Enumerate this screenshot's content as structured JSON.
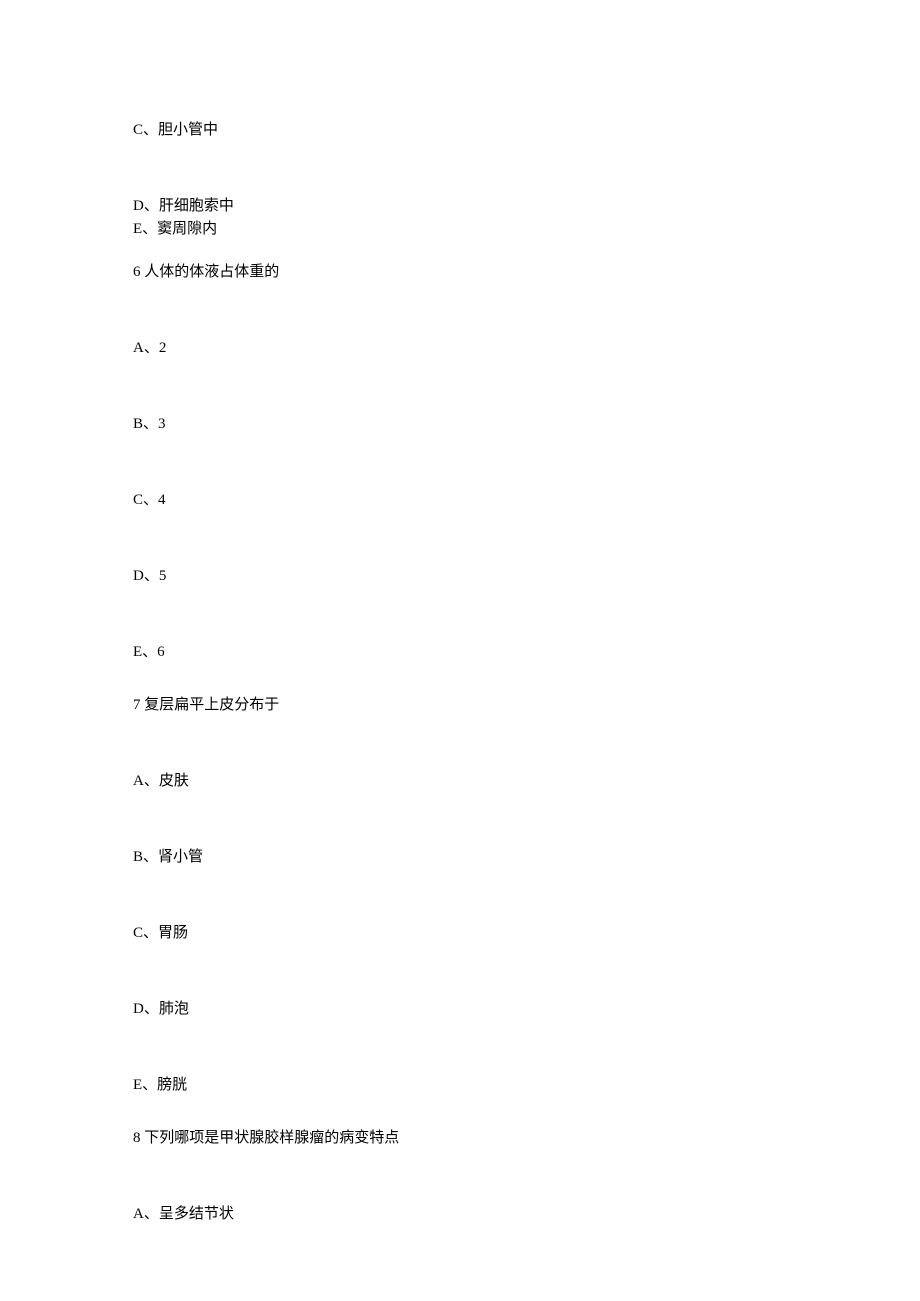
{
  "lines": {
    "l1": "C、胆小管中",
    "l2": "D、肝细胞索中",
    "l3": "E、窦周隙内",
    "q6": "6 人体的体液占体重的",
    "q6a": "A、2",
    "q6b": "B、3",
    "q6c": "C、4",
    "q6d": "D、5",
    "q6e": "E、6",
    "q7": "7 复层扁平上皮分布于",
    "q7a": "A、皮肤",
    "q7b": "B、肾小管",
    "q7c": "C、胃肠",
    "q7d": "D、肺泡",
    "q7e": "E、膀胱",
    "q8": "8 下列哪项是甲状腺胶样腺瘤的病变特点",
    "q8a": "A、呈多结节状"
  }
}
